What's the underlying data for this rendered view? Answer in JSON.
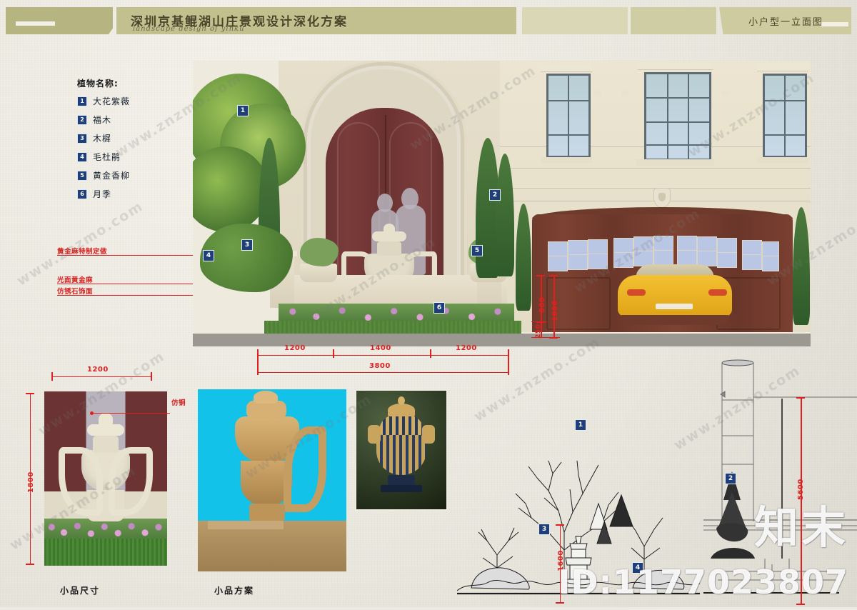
{
  "header": {
    "title": "深圳京基鲲湖山庄景观设计深化方案",
    "subtitle": "landscape design of yinku",
    "right_title": "小户型一立面图"
  },
  "legend": {
    "title": "植物名称:",
    "items": [
      {
        "num": "1",
        "name": "大花紫薇"
      },
      {
        "num": "2",
        "name": "福木"
      },
      {
        "num": "3",
        "name": "木樨"
      },
      {
        "num": "4",
        "name": "毛杜鹃"
      },
      {
        "num": "5",
        "name": "黄金香柳"
      },
      {
        "num": "6",
        "name": "月季"
      }
    ]
  },
  "material_notes": [
    {
      "text": "黄金麻特制定做"
    },
    {
      "text": "光面黄金麻"
    },
    {
      "text": "仿锈石饰面"
    }
  ],
  "elevation": {
    "markers": [
      "1",
      "2",
      "3",
      "4",
      "5",
      "6"
    ],
    "horizontal_dims": [
      "1200",
      "1400",
      "1200"
    ],
    "total_dim": "3800",
    "vertical_dims": [
      "800",
      "1000",
      "250"
    ]
  },
  "panels": {
    "ornament_size": {
      "caption": "小品尺寸",
      "width_dim": "1200",
      "height_dim": "1800",
      "note": "仿铜"
    },
    "ornament_scheme": {
      "caption": "小品方案"
    }
  },
  "sketch": {
    "markers": [
      "1",
      "3",
      "4"
    ],
    "dim": "1600"
  },
  "right_drawing": {
    "dim": "5600",
    "markers": [
      "2"
    ]
  },
  "watermarks": {
    "site": "www.znzmo.com",
    "brand": "知末",
    "id": "ID:1177023807"
  },
  "colors": {
    "title_bar": "#c2c08e",
    "marker_blue": "#1f3f7a",
    "dim_red": "#e21f1f",
    "note_red": "#d81f1f"
  }
}
